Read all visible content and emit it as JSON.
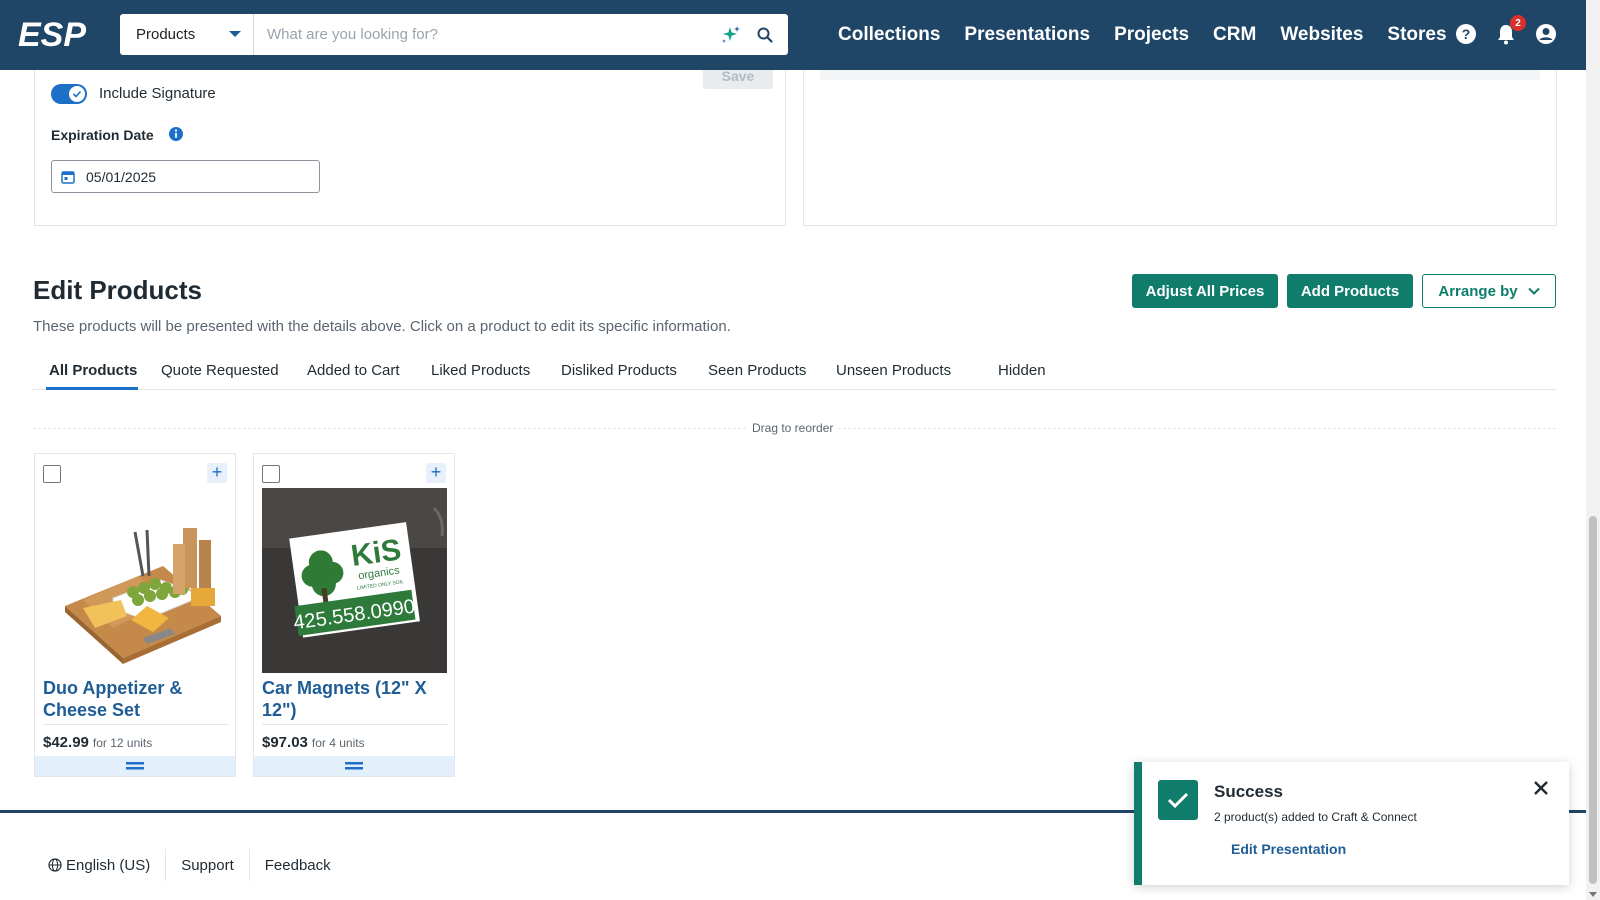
{
  "header": {
    "logo_text": "ESP",
    "search": {
      "category": "Products",
      "placeholder": "What are you looking for?"
    },
    "nav": [
      "Collections",
      "Presentations",
      "Projects",
      "CRM",
      "Websites",
      "Stores"
    ],
    "notification_count": "2"
  },
  "settings": {
    "save_label": "Save",
    "include_signature_label": "Include Signature",
    "include_signature_on": true,
    "expiration_label": "Expiration Date",
    "expiration_date": "05/01/2025"
  },
  "edit_products": {
    "title": "Edit Products",
    "description": "These products will be presented with the details above. Click on a product to edit its specific information.",
    "buttons": {
      "adjust": "Adjust All Prices",
      "add": "Add Products",
      "arrange": "Arrange by"
    },
    "tabs": [
      "All Products",
      "Quote Requested",
      "Added to Cart",
      "Liked Products",
      "Disliked Products",
      "Seen Products",
      "Unseen Products",
      "Hidden"
    ],
    "active_tab": "All Products",
    "drag_label": "Drag to reorder",
    "products": [
      {
        "name": "Duo Appetizer & Cheese Set",
        "price": "$42.99",
        "units": "for 12 units"
      },
      {
        "name": "Car Magnets (12\" X 12\")",
        "price": "$97.03",
        "units": "for 4 units",
        "image_text": {
          "brand": "KiS",
          "sub": "organics",
          "tagline": "LIMITED ONLY SOIL",
          "phone": "425.558.0990"
        }
      }
    ]
  },
  "footer": {
    "language": "English (US)",
    "support": "Support",
    "feedback": "Feedback"
  },
  "toast": {
    "title": "Success",
    "message": "2 product(s) added to Craft & Connect",
    "link": "Edit Presentation"
  },
  "colors": {
    "nav_bg": "#1f4567",
    "primary_green": "#0f7c6c",
    "link_blue": "#1f5d96",
    "toggle_blue": "#1e6fc7"
  }
}
